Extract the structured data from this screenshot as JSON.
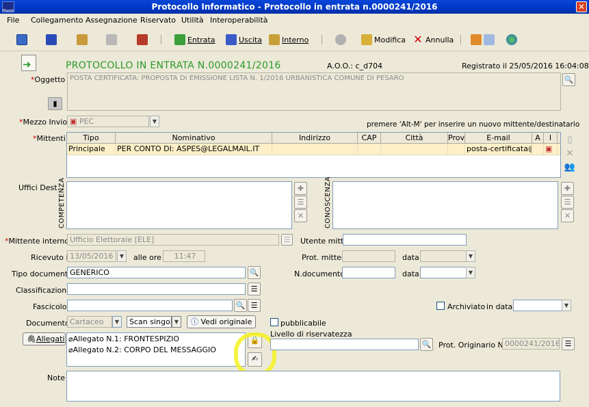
{
  "window": {
    "title": "Protocollo Informatico - Protocollo in entrata n.0000241/2016",
    "close_glyph": "✕",
    "app_icon_text": "Maggioli"
  },
  "menu": [
    "File",
    "Collegamento",
    "Assegnazione",
    "Riservato",
    "Utilità",
    "Interoperabilità"
  ],
  "toolbar": {
    "entrata": "Entrata",
    "uscita": "Uscita",
    "interno": "Interno",
    "modifica": "Modifica",
    "annulla": "Annulla"
  },
  "header": {
    "title": "PROTOCOLLO IN ENTRATA N.0000241/2016",
    "aoo": "A.O.O.: c_d704",
    "registrato": "Registrato il  25/05/2016 16:04:08"
  },
  "oggetto": {
    "label": "Oggetto",
    "value": "POSTA CERTIFICATA: PROPOSTA DI EMISSIONE LISTA N. 1/2016 URBANISTICA COMUNE DI PESARO"
  },
  "mezzo_invio": {
    "label": "Mezzo Invio",
    "value": "PEC",
    "hint": "premere 'Alt-M' per inserire un nuovo mittente/destinatario"
  },
  "mittenti": {
    "label": "Mittenti",
    "columns": [
      "Tipo",
      "Nominativo",
      "Indirizzo",
      "CAP",
      "Città",
      "Prov",
      "E-mail",
      "A",
      "I"
    ],
    "rows": [
      [
        "Principale",
        "PER CONTO DI: ASPES@LEGALMAIL.IT",
        "",
        "",
        "",
        "",
        "posta-certificata@le",
        "",
        ""
      ]
    ]
  },
  "uffici": {
    "label": "Uffici Dest.",
    "competenza": "COMPETENZA",
    "conoscenza": "CONOSCENZA"
  },
  "mittente_interno": {
    "label": "Mittente interno",
    "value": "Ufficio Elettorale [ELE]",
    "utente_label": "Utente mitt.",
    "utente_value": ""
  },
  "ricevuto": {
    "label": "Ricevuto il",
    "date": "13/05/2016",
    "ore_label": "alle ore",
    "ore": "11:47",
    "prot_mittente_label": "Prot. mittente",
    "data_label": "data"
  },
  "tipo_documento": {
    "label": "Tipo documento",
    "value": "GENERICO",
    "ndoc_label": "N.documento",
    "data_label": "data"
  },
  "classificazione": {
    "label": "Classificazione",
    "value": ""
  },
  "fascicolo": {
    "label": "Fascicolo",
    "value": "",
    "archiviato_label": "Archiviato",
    "in_data_label": "in data"
  },
  "documento": {
    "label": "Documento",
    "value": "Cartaceo",
    "scan": "Scan singola",
    "vedi": "Vedi originale",
    "pubblicabile": "pubblicabile"
  },
  "allegati": {
    "button": "Allegati",
    "items": [
      "Allegato N.1: FRONTESPIZIO",
      "Allegato N.2: CORPO DEL MESSAGGIO"
    ],
    "riservatezza_label": "Livello di riservatezza",
    "prot_orig_label": "Prot. Originario N.",
    "prot_orig_value": "0000241/2016"
  },
  "note": {
    "label": "Note",
    "value": ""
  },
  "colors": {
    "title_green": "#2a9a2a",
    "required_red": "#d00000",
    "highlight": "#f4f222",
    "selected_row": "#fdf0c8"
  }
}
